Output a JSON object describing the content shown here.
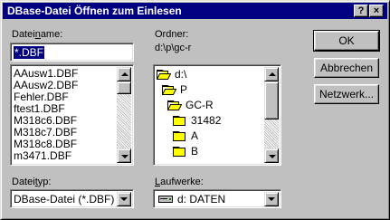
{
  "window": {
    "title": "DBase-Datei Öffnen zum Einlesen",
    "help_label": "?",
    "close_label": "×"
  },
  "filename": {
    "label_prefix": "Datei",
    "label_accel": "n",
    "label_suffix": "ame:",
    "value": "*.DBF",
    "files": [
      "AAusw1.DBF",
      "AAusw2.DBF",
      "Fehler.DBF",
      "ftest1.DBF",
      "M318c6.DBF",
      "M318c7.DBF",
      "M318c8.DBF",
      "m3471.DBF"
    ]
  },
  "folder": {
    "label": "Ordner:",
    "path": "d:\\p\\gc-r",
    "dirs": [
      "d:\\",
      "P",
      "GC-R",
      "31482",
      "A",
      "B"
    ]
  },
  "buttons": {
    "ok": "OK",
    "cancel": "Abbrechen",
    "network": "Netzwerk..."
  },
  "filetype": {
    "label_prefix": "Datei",
    "label_accel": "t",
    "label_suffix": "yp:",
    "value": "DBase-Datei (*.DBF)"
  },
  "drives": {
    "label_prefix": "",
    "label_accel": "L",
    "label_suffix": "aufwerke:",
    "value": "d: DATEN"
  }
}
